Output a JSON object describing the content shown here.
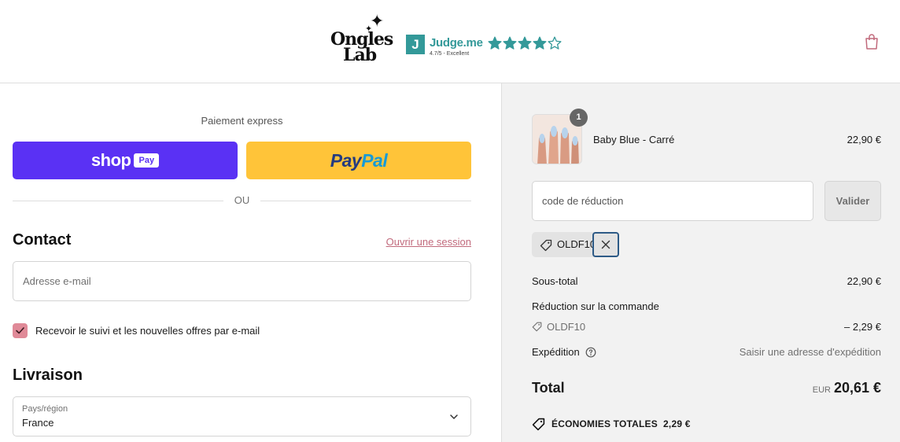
{
  "header": {
    "logo_line1": "Ongles",
    "logo_line2": "Lab",
    "judge_badge": "J",
    "judge_name": "Judge.me",
    "judge_rating": "4.7/5 - Excellent",
    "stars_filled": 4,
    "stars_total": 5
  },
  "express": {
    "title": "Paiement express",
    "shop_word": "shop",
    "shop_pay": "Pay",
    "paypal_pay": "Pay",
    "paypal_pal": "Pal",
    "or_text": "OU"
  },
  "contact": {
    "title": "Contact",
    "login_link": "Ouvrir une session",
    "email_placeholder": "Adresse e-mail",
    "newsletter_label": "Recevoir le suivi et les nouvelles offres par e-mail",
    "newsletter_checked": true
  },
  "delivery": {
    "title": "Livraison",
    "country_label": "Pays/région",
    "country_value": "France"
  },
  "summary": {
    "product": {
      "quantity": "1",
      "name": "Baby Blue - Carré",
      "price": "22,90 €"
    },
    "discount_placeholder": "code de réduction",
    "validate_label": "Valider",
    "applied_code": "OLDF10",
    "subtotal_label": "Sous-total",
    "subtotal_value": "22,90 €",
    "order_discount_label": "Réduction sur la commande",
    "discount_code": "OLDF10",
    "discount_value": "– 2,29 €",
    "shipping_label": "Expédition",
    "shipping_value": "Saisir une adresse d'expédition",
    "total_label": "Total",
    "currency": "EUR",
    "total_value": "20,61 €",
    "savings_label": "ÉCONOMIES TOTALES",
    "savings_value": "2,29 €"
  },
  "colors": {
    "shop_pay": "#5a31f4",
    "paypal": "#ffc439",
    "accent_pink": "#c16a7c",
    "judge_teal": "#339999"
  }
}
